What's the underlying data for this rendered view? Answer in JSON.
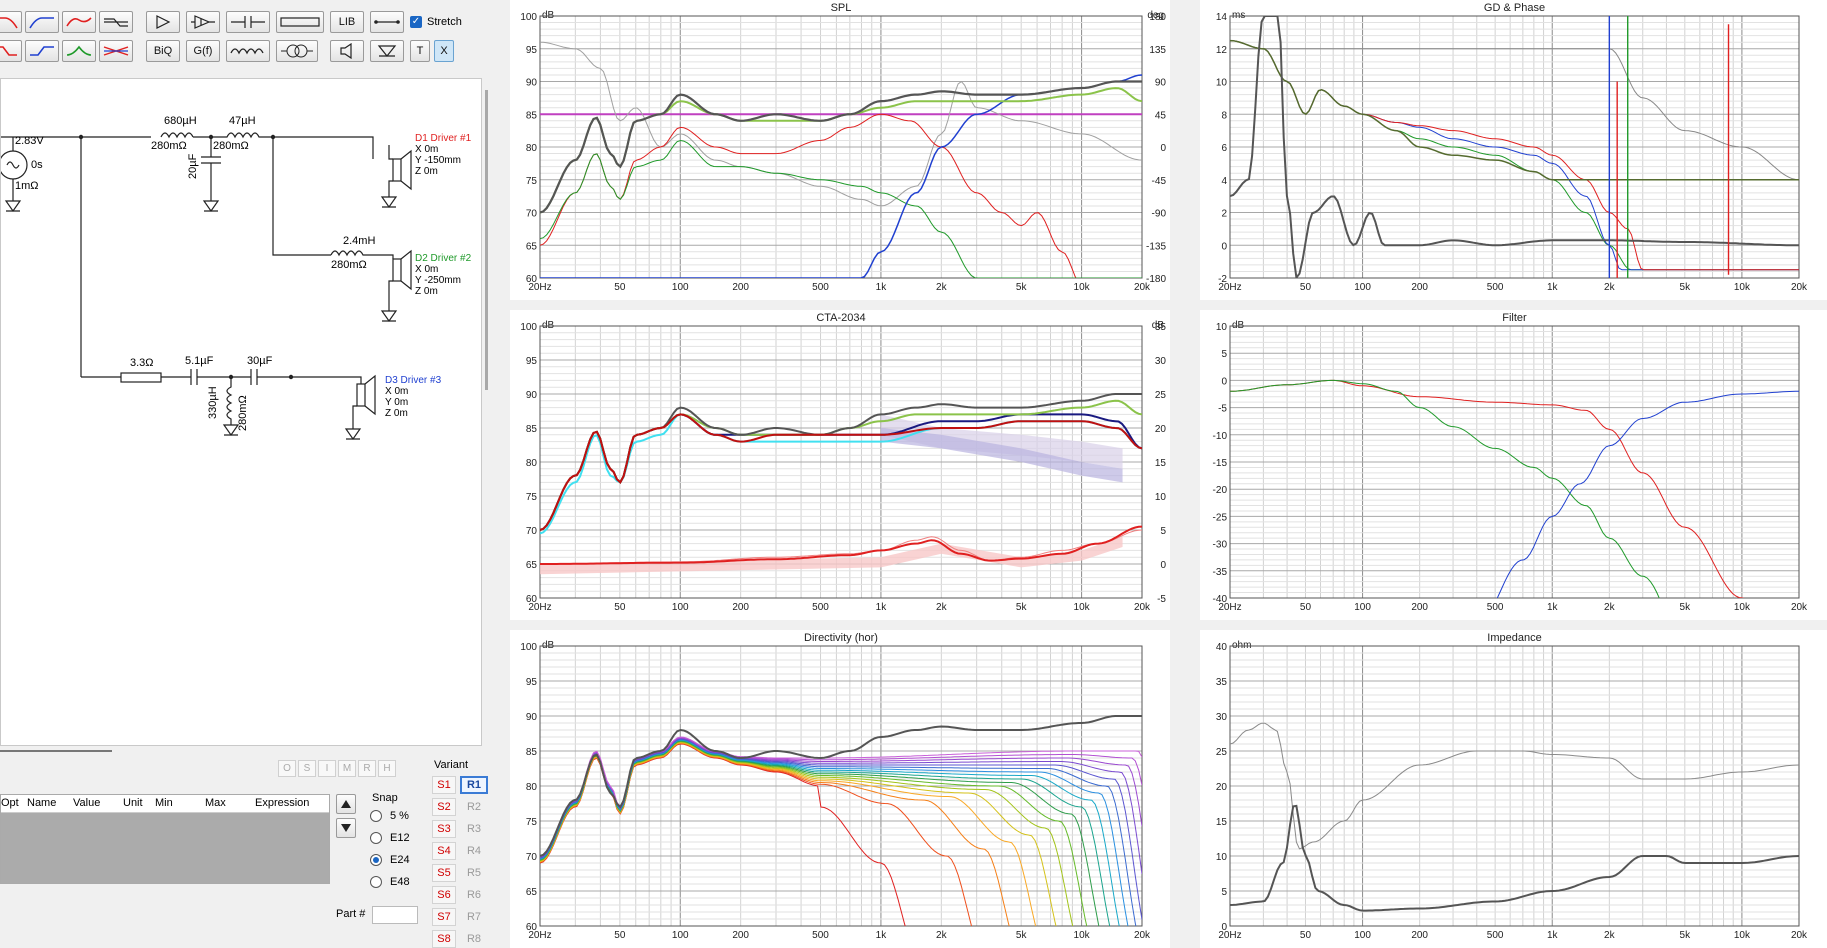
{
  "toolbar": {
    "row1": [
      "lowpass-red",
      "highpass-blue",
      "bandpass-red",
      "notch",
      "allpass",
      "gain",
      "capacitor-series",
      "resistor",
      "LIB",
      "wire"
    ],
    "row2": [
      "lowpass-shelf",
      "highpass-shelf",
      "peak-green",
      "crossover-x",
      "BiQ",
      "G(f)",
      "inductor",
      "transformer",
      "driver",
      "ground",
      "T",
      "X"
    ],
    "lib_label": "LIB",
    "biq_label": "BiQ",
    "gf_label": "G(f)",
    "t_label": "T",
    "x_label": "X",
    "stretch_label": "Stretch",
    "stretch_checked": true
  },
  "schematic": {
    "source": {
      "voltage": "2.83V",
      "delay": "0s",
      "resistance": "1mΩ"
    },
    "components": {
      "l1": "680µH",
      "l1_r": "280mΩ",
      "l2": "47µH",
      "l2_r": "280mΩ",
      "c1": "20µF",
      "l3": "2.4mH",
      "l3_r": "280mΩ",
      "r1": "3.3Ω",
      "c2": "5.1µF",
      "c3": "30µF",
      "l4": "330µH",
      "l4_r": "280mΩ"
    },
    "drivers": [
      {
        "name": "D1 Driver #1",
        "x": "X 0m",
        "y": "Y -150mm",
        "z": "Z 0m",
        "color": "#e02020"
      },
      {
        "name": "D2 Driver #2",
        "x": "X 0m",
        "y": "Y -250mm",
        "z": "Z 0m",
        "color": "#1f9a2a"
      },
      {
        "name": "D3 Driver #3",
        "x": "X 0m",
        "y": "Y 0m",
        "z": "Z 0m",
        "color": "#2040d0"
      }
    ]
  },
  "params": {
    "oh_buttons": [
      "O",
      "S",
      "I",
      "M",
      "R",
      "H"
    ],
    "columns": [
      "Opt",
      "Name",
      "Value",
      "Unit",
      "Min",
      "Max",
      "Expression"
    ],
    "snap_label": "Snap",
    "snap_options": [
      "5 %",
      "E12",
      "E24",
      "E48"
    ],
    "snap_selected": "E24",
    "part_label": "Part #",
    "variant_label": "Variant",
    "variants_s": [
      "S1",
      "S2",
      "S3",
      "S4",
      "S5",
      "S6",
      "S7",
      "S8"
    ],
    "variants_r": [
      "R1",
      "R2",
      "R3",
      "R4",
      "R5",
      "R6",
      "R7",
      "R8"
    ],
    "variant_active": "R1"
  },
  "charts": {
    "x_ticks": [
      "20Hz",
      "50",
      "100",
      "200",
      "500",
      "1k",
      "2k",
      "5k",
      "10k",
      "20k"
    ],
    "spl": {
      "title": "SPL",
      "ylabel": "dB",
      "y2label": "deg",
      "y_ticks": [
        "100",
        "95",
        "90",
        "85",
        "80",
        "75",
        "70",
        "65",
        "60"
      ],
      "y2_ticks": [
        "180",
        "135",
        "90",
        "45",
        "0",
        "-45",
        "-90",
        "-135",
        "-180"
      ]
    },
    "cta": {
      "title": "CTA-2034",
      "ylabel": "dB",
      "y2label": "dB",
      "y_ticks": [
        "100",
        "95",
        "90",
        "85",
        "80",
        "75",
        "70",
        "65",
        "60"
      ],
      "y2_ticks": [
        "35",
        "30",
        "25",
        "20",
        "15",
        "10",
        "5",
        "0",
        "-5"
      ]
    },
    "dir": {
      "title": "Directivity (hor)",
      "ylabel": "dB",
      "y_ticks": [
        "100",
        "95",
        "90",
        "85",
        "80",
        "75",
        "70",
        "65",
        "60"
      ]
    },
    "gd": {
      "title": "GD & Phase",
      "ylabel": "ms",
      "y_ticks": [
        "14",
        "12",
        "10",
        "8",
        "6",
        "4",
        "2",
        "0",
        "-2"
      ]
    },
    "filter": {
      "title": "Filter",
      "ylabel": "dB",
      "y_ticks": [
        "10",
        "5",
        "0",
        "-5",
        "-10",
        "-15",
        "-20",
        "-25",
        "-30",
        "-35",
        "-40"
      ]
    },
    "imp": {
      "title": "Impedance",
      "ylabel": "ohm",
      "y_ticks": [
        "40",
        "35",
        "30",
        "25",
        "20",
        "15",
        "10",
        "5",
        "0"
      ]
    }
  }
}
